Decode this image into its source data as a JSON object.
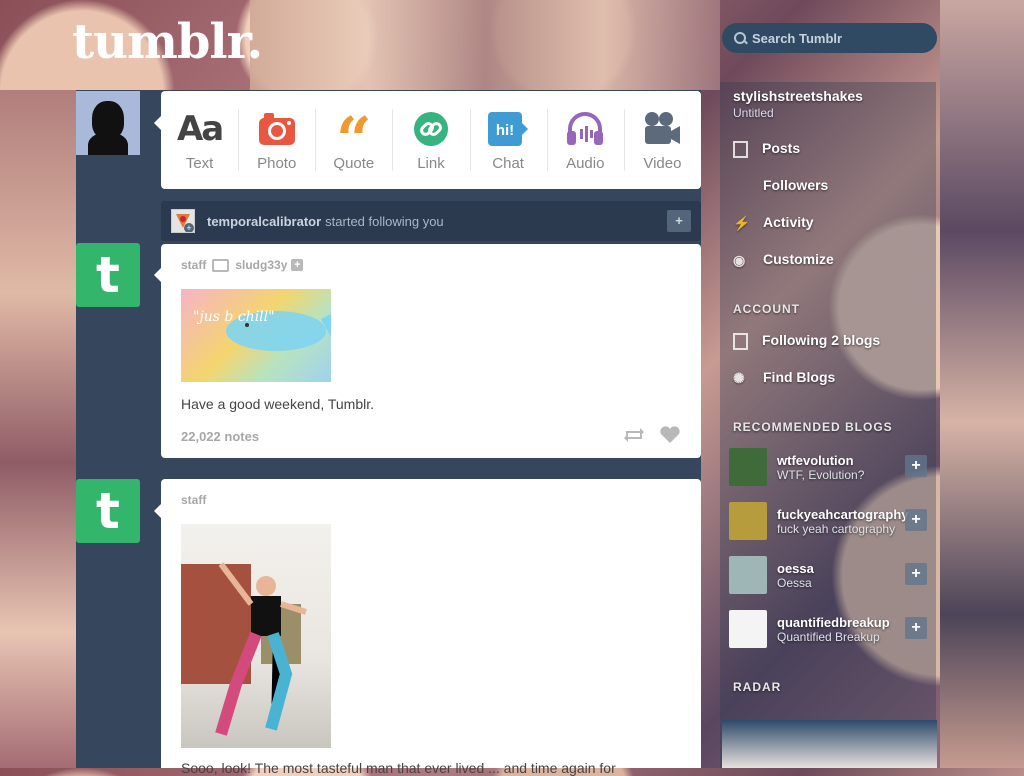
{
  "header": {
    "logo": "tumblr.",
    "search_placeholder": "Search Tumblr"
  },
  "post_types": [
    {
      "label": "Text",
      "icon": "text-icon",
      "color": "#444444"
    },
    {
      "label": "Photo",
      "icon": "camera-icon",
      "color": "#e8573f"
    },
    {
      "label": "Quote",
      "icon": "quote-icon",
      "color": "#f2992e"
    },
    {
      "label": "Link",
      "icon": "link-icon",
      "color": "#36b37e"
    },
    {
      "label": "Chat",
      "icon": "chat-icon",
      "color": "#3e9bd4"
    },
    {
      "label": "Audio",
      "icon": "headphones-icon",
      "color": "#9666b8"
    },
    {
      "label": "Video",
      "icon": "video-camera-icon",
      "color": "#5d6a7b"
    }
  ],
  "notification": {
    "username": "temporalcalibrator",
    "text": "started following you",
    "action": "+"
  },
  "posts": [
    {
      "author": "staff",
      "reblogged_from": "sludg33y",
      "image_text": "\"jus b chill\"",
      "caption": "Have a good weekend, Tumblr.",
      "notes": "22,022 notes"
    },
    {
      "author": "staff",
      "caption": "Sooo, look! The most tasteful man that ever lived ... and time again for"
    }
  ],
  "sidebar": {
    "blog_name": "stylishstreetshakes",
    "blog_sub": "Untitled",
    "items": [
      {
        "label": "Posts",
        "icon": "document-icon"
      },
      {
        "label": "Followers",
        "icon": "person-icon"
      },
      {
        "label": "Activity",
        "icon": "lightning-icon"
      },
      {
        "label": "Customize",
        "icon": "eye-icon"
      }
    ],
    "account_label": "ACCOUNT",
    "account_items": [
      {
        "label": "Following 2 blogs",
        "icon": "list-icon"
      },
      {
        "label": "Find Blogs",
        "icon": "sparkle-icon"
      }
    ],
    "recommended_label": "RECOMMENDED BLOGS",
    "recommended": [
      {
        "name": "wtfevolution",
        "subtitle": "WTF, Evolution?",
        "color": "#3f6a3a"
      },
      {
        "name": "fuckyeahcartography",
        "subtitle": "fuck yeah cartography",
        "color": "#b79c3e"
      },
      {
        "name": "oessa",
        "subtitle": "Oessa",
        "color": "#9fb6b7"
      },
      {
        "name": "quantifiedbreakup",
        "subtitle": "Quantified Breakup",
        "color": "#f4f4f4"
      }
    ],
    "radar_label": "RADAR"
  }
}
